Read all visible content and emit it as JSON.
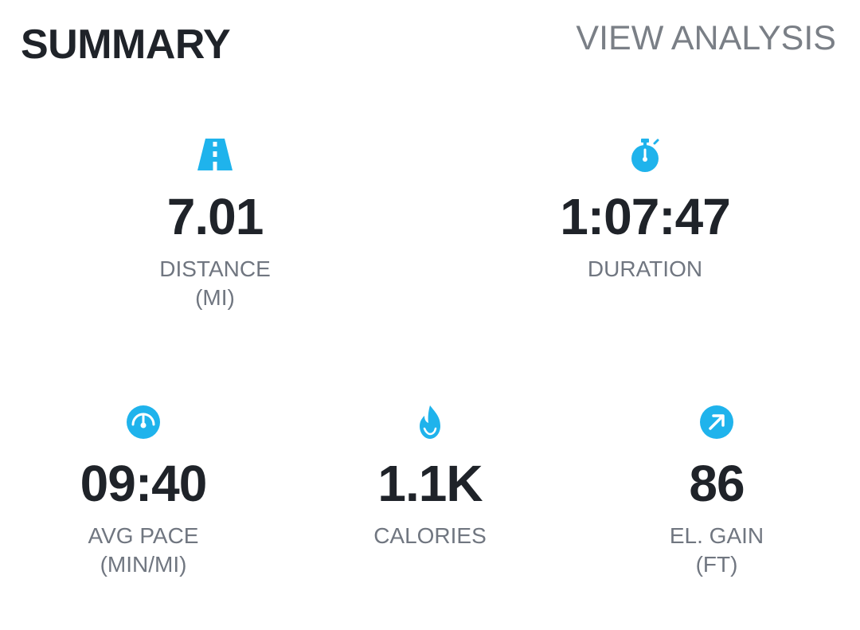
{
  "header": {
    "title": "SUMMARY",
    "link": "VIEW ANALYSIS"
  },
  "colors": {
    "accent": "#1fb3ec",
    "value_text": "#1f2329",
    "label_text": "#707680",
    "link_text": "#7a7f86"
  },
  "stats": {
    "distance": {
      "icon": "road-icon",
      "value": "7.01",
      "label": "DISTANCE",
      "unit": "(MI)"
    },
    "duration": {
      "icon": "stopwatch-icon",
      "value": "1:07:47",
      "label": "DURATION"
    },
    "pace": {
      "icon": "speedometer-icon",
      "value": "09:40",
      "label": "AVG PACE",
      "unit": "(MIN/MI)"
    },
    "calories": {
      "icon": "flame-icon",
      "value": "1.1K",
      "label": "CALORIES"
    },
    "elgain": {
      "icon": "arrow-up-right-icon",
      "value": "86",
      "label": "EL. GAIN",
      "unit": "(FT)"
    }
  }
}
